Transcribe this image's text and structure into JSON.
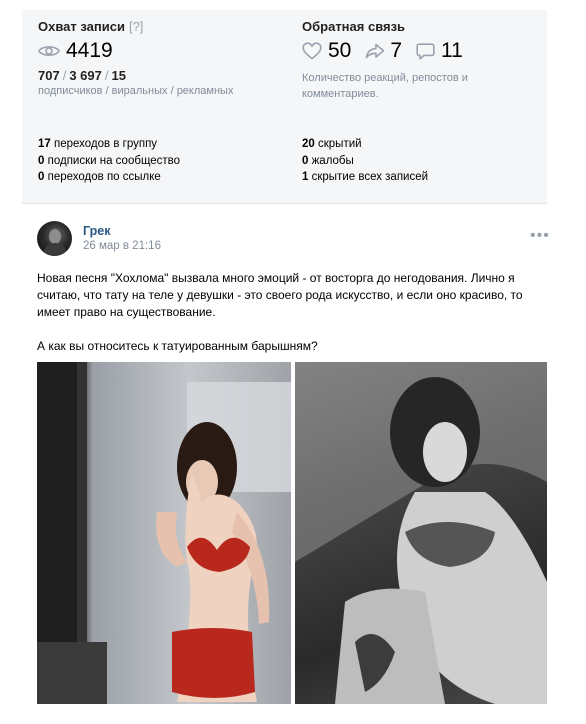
{
  "stats": {
    "reach": {
      "title": "Охват записи",
      "help": "[?]",
      "icon": "eye-icon",
      "views": "4419",
      "breakdown": [
        "707",
        "3 697",
        "15"
      ],
      "separator": "/",
      "breakdown_caption": "подписчиков / виральных / рекламных"
    },
    "feedback": {
      "title": "Обратная связь",
      "likes": "50",
      "reposts": "7",
      "comments": "11",
      "icons": [
        "heart-icon",
        "share-arrow-icon",
        "comment-icon"
      ],
      "description": "Количество реакций, репостов и комментариев."
    },
    "left_list": [
      {
        "count": "17",
        "label": "переходов в группу"
      },
      {
        "count": "0",
        "label": "подписки на сообщество"
      },
      {
        "count": "0",
        "label": "переходов по ссылке"
      }
    ],
    "right_list": [
      {
        "count": "20",
        "label": "скрытий"
      },
      {
        "count": "0",
        "label": "жалобы"
      },
      {
        "count": "1",
        "label": "скрытие всех записей"
      }
    ]
  },
  "post": {
    "author": "Грек",
    "date": "26 мар в 21:16",
    "more": "•••",
    "text_paragraph1": "Новая песня \"Хохлома\" вызвала много эмоций - от восторга до негодования. Лично я считаю, что тату на теле у девушки - это своего рода искусство, и если оно красиво, то имеет право на существование.",
    "text_paragraph2": "А как вы относитесь к татуированным барышням?"
  },
  "colors": {
    "panel_bg": "#f5f6f8",
    "link": "#2a5885",
    "muted": "#818c99",
    "icon": "#99a2ad",
    "lingerie_red": "#b8281c"
  }
}
